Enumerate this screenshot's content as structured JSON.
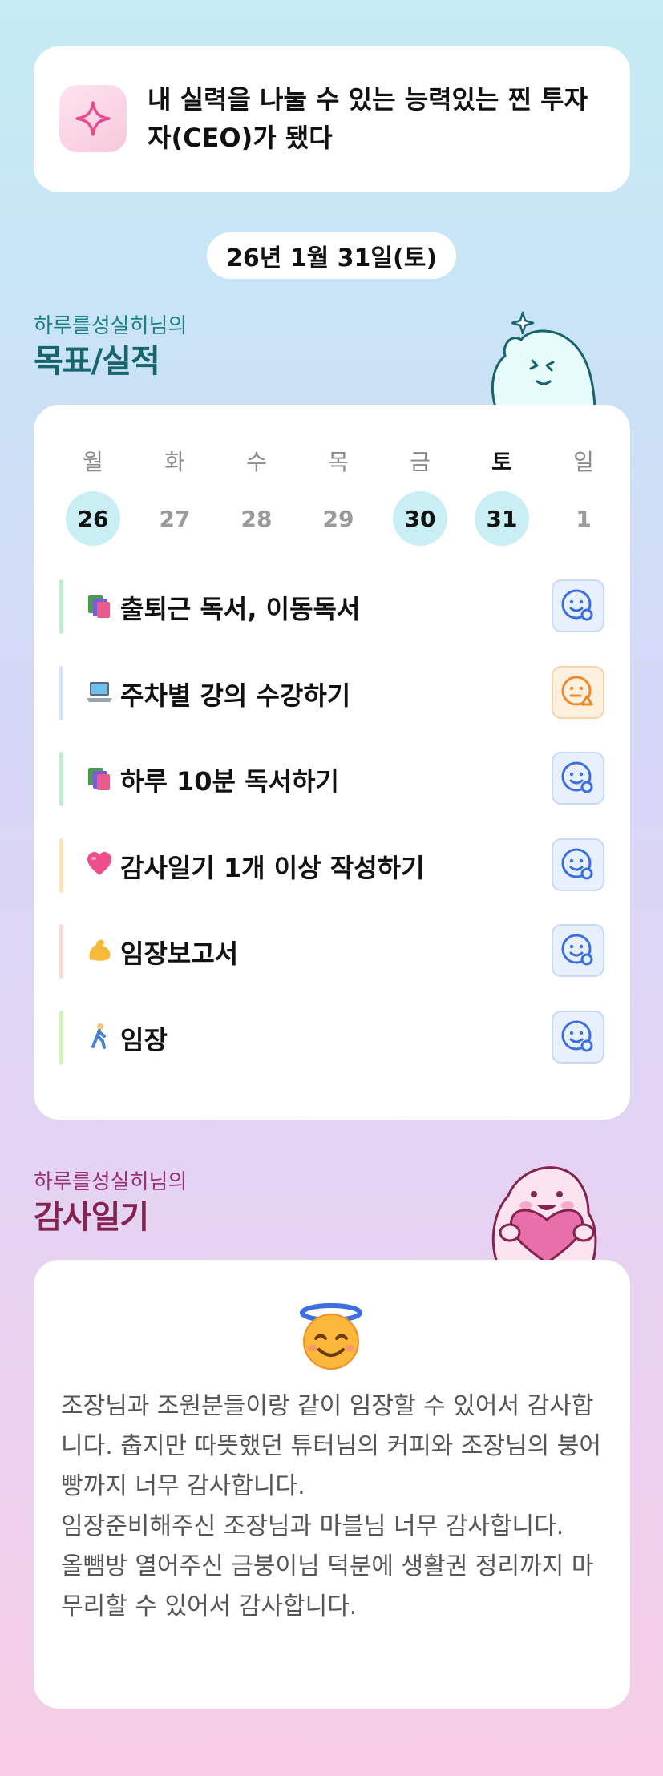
{
  "quote": {
    "text": "내 실력을 나눌 수 있는 능력있는 찐 투자자(CEO)가 됐다",
    "icon": "sparkle-icon"
  },
  "date_label": "26년 1월 31일(토)",
  "goals_section": {
    "owner": "하루를성실히님의",
    "title": "목표/실적"
  },
  "calendar": {
    "days": [
      {
        "name": "월",
        "num": "26",
        "achieved": true,
        "today": false
      },
      {
        "name": "화",
        "num": "27",
        "achieved": false,
        "today": false
      },
      {
        "name": "수",
        "num": "28",
        "achieved": false,
        "today": false
      },
      {
        "name": "목",
        "num": "29",
        "achieved": false,
        "today": false
      },
      {
        "name": "금",
        "num": "30",
        "achieved": true,
        "today": false
      },
      {
        "name": "토",
        "num": "31",
        "achieved": true,
        "today": true
      },
      {
        "name": "일",
        "num": "1",
        "achieved": false,
        "today": false
      }
    ]
  },
  "goals": [
    {
      "emoji": "books-icon",
      "label": "출퇴근 독서, 이동독서",
      "status": "done",
      "bar_color": "#bfeccf"
    },
    {
      "emoji": "laptop-icon",
      "label": "주차별 강의 수강하기",
      "status": "partial",
      "bar_color": "#d6e1f7"
    },
    {
      "emoji": "books-icon",
      "label": "하루 10분 독서하기",
      "status": "done",
      "bar_color": "#bfeccf"
    },
    {
      "emoji": "heart-icon",
      "label": "감사일기 1개 이상 작성하기",
      "status": "done",
      "bar_color": "#fbe2bf"
    },
    {
      "emoji": "flexed-arm-icon",
      "label": "임장보고서",
      "status": "done",
      "bar_color": "#fbd9d9"
    },
    {
      "emoji": "walking-person-icon",
      "label": "임장",
      "status": "done",
      "bar_color": "#d4f0bd"
    }
  ],
  "diary_section": {
    "owner": "하루를성실히님의",
    "title": "감사일기",
    "emoji": "smiling-face-with-halo-icon",
    "text": "조장님과 조원분들이랑 같이 임장할 수 있어서 감사합니다. 춥지만 따뜻했던 튜터님의 커피와 조장님의 붕어빵까지 너무 감사합니다.\n임장준비해주신 조장님과 마블님 너무 감사합니다.\n올뺌방 열어주신 금붕이님 덕분에 생활권 정리까지 마무리할 수 있어서 감사합니다."
  }
}
